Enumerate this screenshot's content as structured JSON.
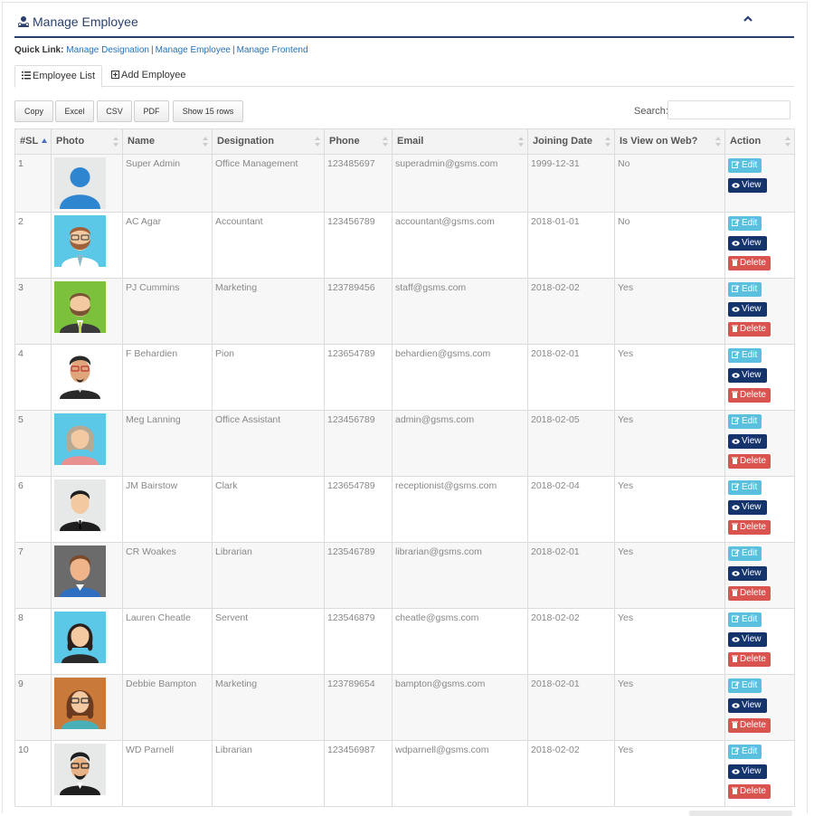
{
  "header": {
    "title": "Manage Employee",
    "icon": "user-group-icon",
    "collapse_icon": "chevron-up-icon"
  },
  "quick_links": {
    "label": "Quick Link:",
    "links": [
      "Manage Designation",
      "Manage Employee",
      "Manage Frontend"
    ],
    "separator": "|"
  },
  "tabs": [
    {
      "label": "Employee List",
      "icon": "list-icon",
      "active": true
    },
    {
      "label": "Add Employee",
      "icon": "plus-square-icon",
      "active": false
    }
  ],
  "toolbar": {
    "copy": "Copy",
    "excel": "Excel",
    "csv": "CSV",
    "pdf": "PDF",
    "show_rows": "Show 15 rows"
  },
  "search": {
    "label": "Search:",
    "value": "",
    "placeholder": ""
  },
  "table": {
    "columns": [
      "#SL",
      "Photo",
      "Name",
      "Designation",
      "Phone",
      "Email",
      "Joining Date",
      "Is View on Web?",
      "Action"
    ],
    "action_labels": {
      "edit": "Edit",
      "view": "View",
      "delete": "Delete"
    },
    "rows": [
      {
        "sl": "1",
        "name": "Super Admin",
        "designation": "Office Management",
        "phone": "123485697",
        "email": "superadmin@gsms.com",
        "joining": "1999-12-31",
        "web": "No",
        "avatar": "placeholder",
        "delete": false
      },
      {
        "sl": "2",
        "name": "AC Agar",
        "designation": "Accountant",
        "phone": "123456789",
        "email": "accountant@gsms.com",
        "joining": "2018-01-01",
        "web": "No",
        "avatar": "man-beard-glasses",
        "delete": true
      },
      {
        "sl": "3",
        "name": "PJ Cummins",
        "designation": "Marketing",
        "phone": "123789456",
        "email": "staff@gsms.com",
        "joining": "2018-02-02",
        "web": "Yes",
        "avatar": "man-beard-green",
        "delete": true
      },
      {
        "sl": "4",
        "name": "F Behardien",
        "designation": "Pion",
        "phone": "123654789",
        "email": "behardien@gsms.com",
        "joining": "2018-02-01",
        "web": "Yes",
        "avatar": "man-goatee",
        "delete": true
      },
      {
        "sl": "5",
        "name": "Meg Lanning",
        "designation": "Office Assistant",
        "phone": "123456789",
        "email": "admin@gsms.com",
        "joining": "2018-02-05",
        "web": "Yes",
        "avatar": "woman-grey-hair",
        "delete": true
      },
      {
        "sl": "6",
        "name": "JM Bairstow",
        "designation": "Clark",
        "phone": "123654789",
        "email": "receptionist@gsms.com",
        "joining": "2018-02-04",
        "web": "Yes",
        "avatar": "man-suit",
        "delete": true
      },
      {
        "sl": "7",
        "name": "CR Woakes",
        "designation": "Librarian",
        "phone": "123546789",
        "email": "librarian@gsms.com",
        "joining": "2018-02-01",
        "web": "Yes",
        "avatar": "man-blank-face",
        "delete": true
      },
      {
        "sl": "8",
        "name": "Lauren Cheatle",
        "designation": "Servent",
        "phone": "123546879",
        "email": "cheatle@gsms.com",
        "joining": "2018-02-02",
        "web": "Yes",
        "avatar": "woman-dark-hair",
        "delete": true
      },
      {
        "sl": "9",
        "name": "Debbie Bampton",
        "designation": "Marketing",
        "phone": "123789654",
        "email": "bampton@gsms.com",
        "joining": "2018-02-01",
        "web": "Yes",
        "avatar": "woman-glasses",
        "delete": true
      },
      {
        "sl": "10",
        "name": "WD Parnell",
        "designation": "Librarian",
        "phone": "123456987",
        "email": "wdparnell@gsms.com",
        "joining": "2018-02-02",
        "web": "Yes",
        "avatar": "man-glasses-beard",
        "delete": true
      }
    ]
  },
  "colors": {
    "accent": "#2a3f6e",
    "link": "#2a72b5",
    "edit": "#5bc0de",
    "view": "#14346b",
    "delete": "#d9534f"
  }
}
